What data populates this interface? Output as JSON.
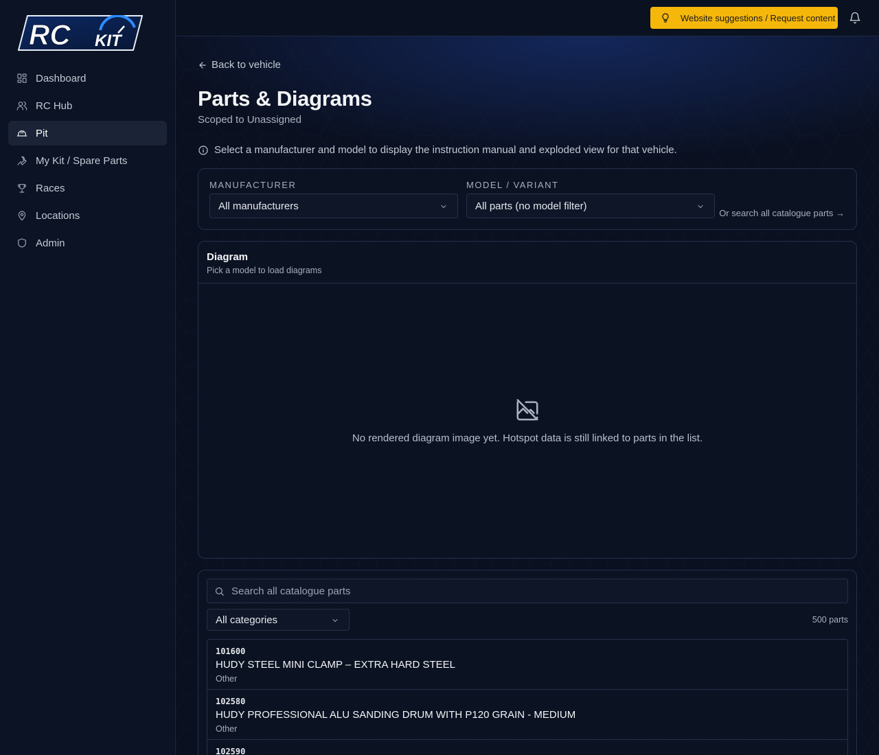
{
  "brand": {
    "logo_rc": "RC",
    "logo_kit": "KIT",
    "accent": "#1e6bff",
    "warning": "#f5b70a"
  },
  "sidebar": {
    "items": [
      {
        "label": "Dashboard",
        "icon": "dashboard-icon",
        "active": false
      },
      {
        "label": "RC Hub",
        "icon": "users-icon",
        "active": false
      },
      {
        "label": "Pit",
        "icon": "hard-hat-icon",
        "active": true
      },
      {
        "label": "My Kit / Spare Parts",
        "icon": "wrench-icon",
        "active": false
      },
      {
        "label": "Races",
        "icon": "trophy-icon",
        "active": false
      },
      {
        "label": "Locations",
        "icon": "map-pin-icon",
        "active": false
      },
      {
        "label": "Admin",
        "icon": "shield-icon",
        "active": false
      }
    ]
  },
  "topbar": {
    "suggest_label": "Website suggestions / Request content",
    "suggest_icon": "lightbulb-icon",
    "bell_icon": "bell-icon"
  },
  "page": {
    "back_label": "Back to vehicle",
    "title": "Parts & Diagrams",
    "subtitle": "Scoped to Unassigned",
    "info": "Select a manufacturer and model to display the instruction manual and exploded view for that vehicle."
  },
  "filters": {
    "manufacturer_label": "MANUFACTURER",
    "manufacturer_value": "All manufacturers",
    "model_label": "MODEL / VARIANT",
    "model_value": "All parts (no model filter)",
    "search_link": "Or search all catalogue parts →"
  },
  "diagram": {
    "title": "Diagram",
    "subtitle": "Pick a model to load diagrams",
    "empty_icon": "image-off-icon",
    "empty_text": "No rendered diagram image yet. Hotspot data is still linked to parts in the list."
  },
  "parts": {
    "search_placeholder": "Search all catalogue parts",
    "category_value": "All categories",
    "count": "500 parts",
    "rows": [
      {
        "code": "101600",
        "name": "HUDY STEEL MINI CLAMP – EXTRA HARD STEEL",
        "category": "Other"
      },
      {
        "code": "102580",
        "name": "HUDY PROFESSIONAL ALU SANDING DRUM WITH P120 GRAIN - MEDIUM",
        "category": "Other"
      },
      {
        "code": "102590",
        "name": "",
        "category": ""
      }
    ]
  }
}
